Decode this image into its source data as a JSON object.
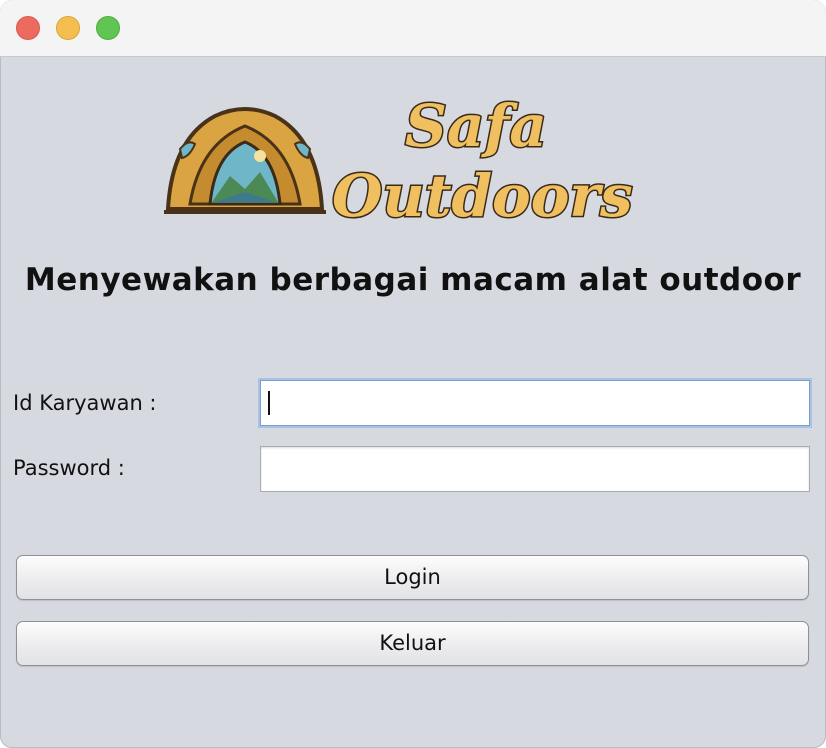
{
  "window": {
    "controls": [
      "close-light",
      "minimize-light",
      "maximize-light"
    ]
  },
  "logo": {
    "word1": "Safa",
    "word2": "Outdoors"
  },
  "tagline": "Menyewakan berbagai macam alat outdoor",
  "form": {
    "id_label": "Id Karyawan :",
    "id_value": "",
    "password_label": "Password :",
    "password_value": ""
  },
  "buttons": {
    "login": "Login",
    "exit": "Keluar"
  },
  "colors": {
    "background": "#d6d9e0",
    "logo_text": "#f0c060",
    "logo_outline": "#3a2a18",
    "focus_ring": "#a8c3e6"
  }
}
